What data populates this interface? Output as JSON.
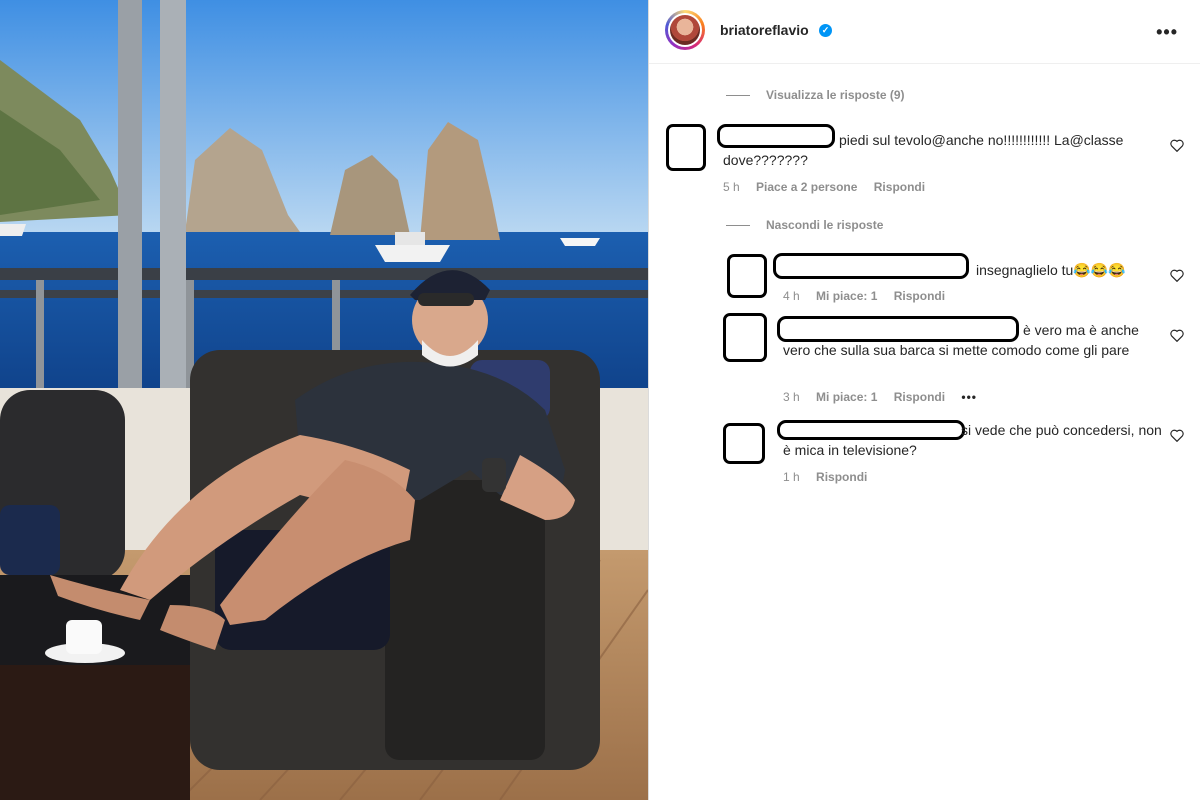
{
  "post": {
    "username": "briatoreflavio",
    "verified_icon": "verified-badge-icon",
    "more_icon": "more-options-icon"
  },
  "threads": {
    "view_replies": "Visualizza le risposte (9)",
    "hide_replies": "Nascondi le risposte"
  },
  "comments": [
    {
      "text": "piedi sul tevolo@anche no!!!!!!!!!!!! La@classe dove???????",
      "time": "5 h",
      "likes": "Piace a 2 persone",
      "reply": "Rispondi"
    },
    {
      "text": "insegnaglielo tu😂😂😂",
      "time": "4 h",
      "likes": "Mi piace: 1",
      "reply": "Rispondi"
    },
    {
      "text": "è vero ma è anche vero che sulla sua barca si mette comodo come gli pare",
      "time": "3 h",
      "likes": "Mi piace: 1",
      "reply": "Rispondi",
      "more": "•••"
    },
    {
      "text": "si vede che può concedersi, non è mica in televisione?",
      "time": "1 h",
      "reply": "Rispondi"
    }
  ],
  "colors": {
    "link_blue": "#0095f6",
    "text": "#262626",
    "muted": "#8e8e8e"
  }
}
